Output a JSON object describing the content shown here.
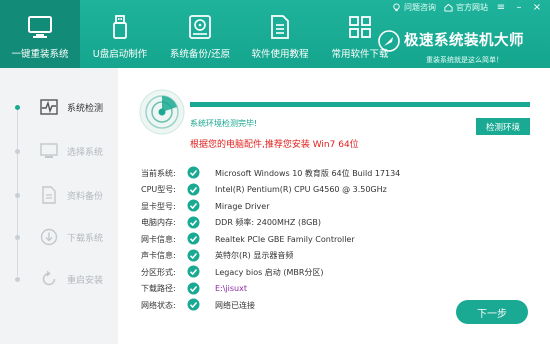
{
  "topbar": {
    "help_label": "问题咨询",
    "site_label": "官方网站"
  },
  "nav": {
    "items": [
      {
        "label": "一键重装系统",
        "icon": "monitor-icon",
        "active": true
      },
      {
        "label": "U盘启动制作",
        "icon": "usb-icon",
        "active": false
      },
      {
        "label": "系统备份/还原",
        "icon": "disk-backup-icon",
        "active": false
      },
      {
        "label": "软件使用教程",
        "icon": "document-icon",
        "active": false
      },
      {
        "label": "常用软件下载",
        "icon": "apps-grid-icon",
        "active": false
      }
    ]
  },
  "brand": {
    "name": "极速系统装机大师",
    "slogan": "重装系统就是这么简单！"
  },
  "steps": [
    {
      "label": "系统检测",
      "icon": "pulse-icon",
      "active": true
    },
    {
      "label": "选择系统",
      "icon": "monitor-icon",
      "active": false
    },
    {
      "label": "资料备份",
      "icon": "file-icon",
      "active": false
    },
    {
      "label": "下载系统",
      "icon": "download-icon",
      "active": false
    },
    {
      "label": "重启安装",
      "icon": "restart-icon",
      "active": false
    }
  ],
  "scan": {
    "progress": 1.0,
    "status_message": "系统环境检测完毕!",
    "recommendation": "根据您的电脑配件,推荐您安装 Win7 64位",
    "detect_button": "检测环境"
  },
  "system_info": [
    {
      "label": "当前系统:",
      "value": "Microsoft Windows 10 教育版 64位 Build 17134"
    },
    {
      "label": "CPU型号:",
      "value": "Intel(R) Pentium(R) CPU G4560 @ 3.50GHz"
    },
    {
      "label": "显卡型号:",
      "value": "Mirage Driver"
    },
    {
      "label": "电脑内存:",
      "value": "DDR 频率: 2400MHZ (8GB)"
    },
    {
      "label": "网卡信息:",
      "value": "Realtek PCIe GBE Family Controller"
    },
    {
      "label": "声卡信息:",
      "value": "英特尔(R) 显示器音频"
    },
    {
      "label": "分区形式:",
      "value": "Legacy bios 启动  (MBR分区)"
    },
    {
      "label": "下载路径:",
      "value": "E:\\jisuxt"
    },
    {
      "label": "网络状态:",
      "value": "网络已连接"
    }
  ],
  "next_button": "下一步",
  "colors": {
    "accent": "#1aa993",
    "header": "#1fb39c",
    "active_nav": "#128c78",
    "recommend_text": "#e0201e",
    "path_text": "#8a2aa0"
  }
}
